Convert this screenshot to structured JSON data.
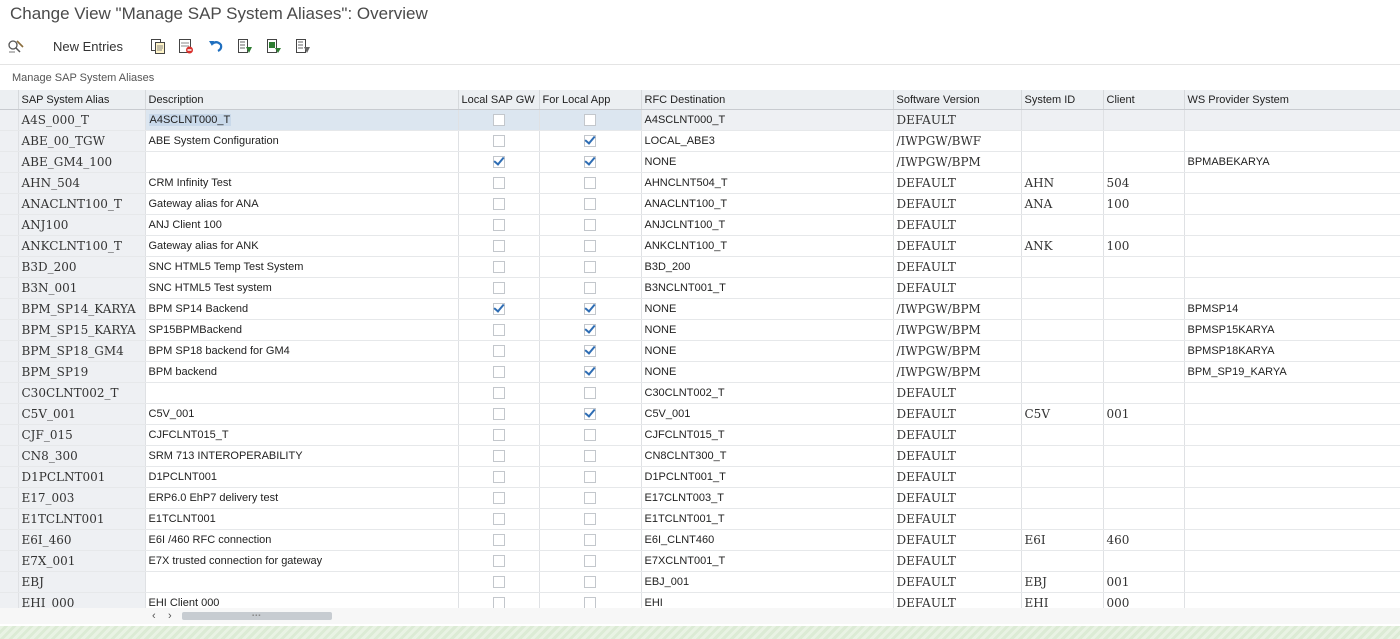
{
  "window": {
    "title": "Change View \"Manage SAP System Aliases\": Overview"
  },
  "toolbar": {
    "new_entries": "New Entries",
    "icons": [
      "display-change-icon",
      "copy-icon",
      "delete-icon",
      "undo-icon",
      "select-all-icon",
      "select-block-icon",
      "deselect-all-icon"
    ]
  },
  "section": {
    "title": "Manage SAP System Aliases"
  },
  "columns": [
    "SAP System Alias",
    "Description",
    "Local SAP GW",
    "For Local App",
    "RFC Destination",
    "Software Version",
    "System ID",
    "Client",
    "WS Provider System"
  ],
  "rows": [
    {
      "alias": "A4S_000_T",
      "desc": "A4SCLNT000_T",
      "gw": false,
      "app": false,
      "rfc": "A4SCLNT000_T",
      "ver": "DEFAULT",
      "sid": "",
      "client": "",
      "ws": ""
    },
    {
      "alias": "ABE_00_TGW",
      "desc": "ABE System Configuration",
      "gw": false,
      "app": true,
      "rfc": "LOCAL_ABE3",
      "ver": "/IWPGW/BWF",
      "sid": "",
      "client": "",
      "ws": ""
    },
    {
      "alias": "ABE_GM4_100",
      "desc": "",
      "gw": true,
      "app": true,
      "rfc": "NONE",
      "ver": "/IWPGW/BPM",
      "sid": "",
      "client": "",
      "ws": "BPMABEKARYA"
    },
    {
      "alias": "AHN_504",
      "desc": "CRM Infinity Test",
      "gw": false,
      "app": false,
      "rfc": "AHNCLNT504_T",
      "ver": "DEFAULT",
      "sid": "AHN",
      "client": "504",
      "ws": ""
    },
    {
      "alias": "ANACLNT100_T",
      "desc": "Gateway alias for ANA",
      "gw": false,
      "app": false,
      "rfc": "ANACLNT100_T",
      "ver": "DEFAULT",
      "sid": "ANA",
      "client": "100",
      "ws": ""
    },
    {
      "alias": "ANJ100",
      "desc": "ANJ Client 100",
      "gw": false,
      "app": false,
      "rfc": "ANJCLNT100_T",
      "ver": "DEFAULT",
      "sid": "",
      "client": "",
      "ws": ""
    },
    {
      "alias": "ANKCLNT100_T",
      "desc": "Gateway alias for ANK",
      "gw": false,
      "app": false,
      "rfc": "ANKCLNT100_T",
      "ver": "DEFAULT",
      "sid": "ANK",
      "client": "100",
      "ws": ""
    },
    {
      "alias": "B3D_200",
      "desc": "SNC HTML5 Temp Test System",
      "gw": false,
      "app": false,
      "rfc": "B3D_200",
      "ver": "DEFAULT",
      "sid": "",
      "client": "",
      "ws": ""
    },
    {
      "alias": "B3N_001",
      "desc": "SNC HTML5 Test system",
      "gw": false,
      "app": false,
      "rfc": "B3NCLNT001_T",
      "ver": "DEFAULT",
      "sid": "",
      "client": "",
      "ws": ""
    },
    {
      "alias": "BPM_SP14_KARYA",
      "desc": "BPM SP14 Backend",
      "gw": true,
      "app": true,
      "rfc": "NONE",
      "ver": "/IWPGW/BPM",
      "sid": "",
      "client": "",
      "ws": "BPMSP14"
    },
    {
      "alias": "BPM_SP15_KARYA",
      "desc": "SP15BPMBackend",
      "gw": false,
      "app": true,
      "rfc": "NONE",
      "ver": "/IWPGW/BPM",
      "sid": "",
      "client": "",
      "ws": "BPMSP15KARYA"
    },
    {
      "alias": "BPM_SP18_GM4",
      "desc": "BPM SP18 backend for GM4",
      "gw": false,
      "app": true,
      "rfc": "NONE",
      "ver": "/IWPGW/BPM",
      "sid": "",
      "client": "",
      "ws": "BPMSP18KARYA"
    },
    {
      "alias": "BPM_SP19",
      "desc": "BPM backend",
      "gw": false,
      "app": true,
      "rfc": "NONE",
      "ver": "/IWPGW/BPM",
      "sid": "",
      "client": "",
      "ws": "BPM_SP19_KARYA"
    },
    {
      "alias": "C30CLNT002_T",
      "desc": "",
      "gw": false,
      "app": false,
      "rfc": "C30CLNT002_T",
      "ver": "DEFAULT",
      "sid": "",
      "client": "",
      "ws": ""
    },
    {
      "alias": "C5V_001",
      "desc": "C5V_001",
      "gw": false,
      "app": true,
      "rfc": "C5V_001",
      "ver": "DEFAULT",
      "sid": "C5V",
      "client": "001",
      "ws": ""
    },
    {
      "alias": "CJF_015",
      "desc": "CJFCLNT015_T",
      "gw": false,
      "app": false,
      "rfc": "CJFCLNT015_T",
      "ver": "DEFAULT",
      "sid": "",
      "client": "",
      "ws": ""
    },
    {
      "alias": "CN8_300",
      "desc": "SRM 713 INTEROPERABILITY",
      "gw": false,
      "app": false,
      "rfc": "CN8CLNT300_T",
      "ver": "DEFAULT",
      "sid": "",
      "client": "",
      "ws": ""
    },
    {
      "alias": "D1PCLNT001",
      "desc": "D1PCLNT001",
      "gw": false,
      "app": false,
      "rfc": "D1PCLNT001_T",
      "ver": "DEFAULT",
      "sid": "",
      "client": "",
      "ws": ""
    },
    {
      "alias": "E17_003",
      "desc": "ERP6.0 EhP7 delivery test",
      "gw": false,
      "app": false,
      "rfc": "E17CLNT003_T",
      "ver": "DEFAULT",
      "sid": "",
      "client": "",
      "ws": ""
    },
    {
      "alias": "E1TCLNT001",
      "desc": "E1TCLNT001",
      "gw": false,
      "app": false,
      "rfc": "E1TCLNT001_T",
      "ver": "DEFAULT",
      "sid": "",
      "client": "",
      "ws": ""
    },
    {
      "alias": "E6I_460",
      "desc": "E6I /460 RFC connection",
      "gw": false,
      "app": false,
      "rfc": "E6I_CLNT460",
      "ver": "DEFAULT",
      "sid": "E6I",
      "client": "460",
      "ws": ""
    },
    {
      "alias": "E7X_001",
      "desc": "E7X trusted connection for gateway",
      "gw": false,
      "app": false,
      "rfc": "E7XCLNT001_T",
      "ver": "DEFAULT",
      "sid": "",
      "client": "",
      "ws": ""
    },
    {
      "alias": "EBJ",
      "desc": "",
      "gw": false,
      "app": false,
      "rfc": "EBJ_001",
      "ver": "DEFAULT",
      "sid": "EBJ",
      "client": "001",
      "ws": ""
    },
    {
      "alias": "EHI_000",
      "desc": "EHI Client 000",
      "gw": false,
      "app": false,
      "rfc": "EHI",
      "ver": "DEFAULT",
      "sid": "EHI",
      "client": "000",
      "ws": ""
    }
  ],
  "scrollbar": {
    "left_arrow": "‹",
    "right_arrow": "›",
    "thumb_grip": "▪▪▪"
  }
}
